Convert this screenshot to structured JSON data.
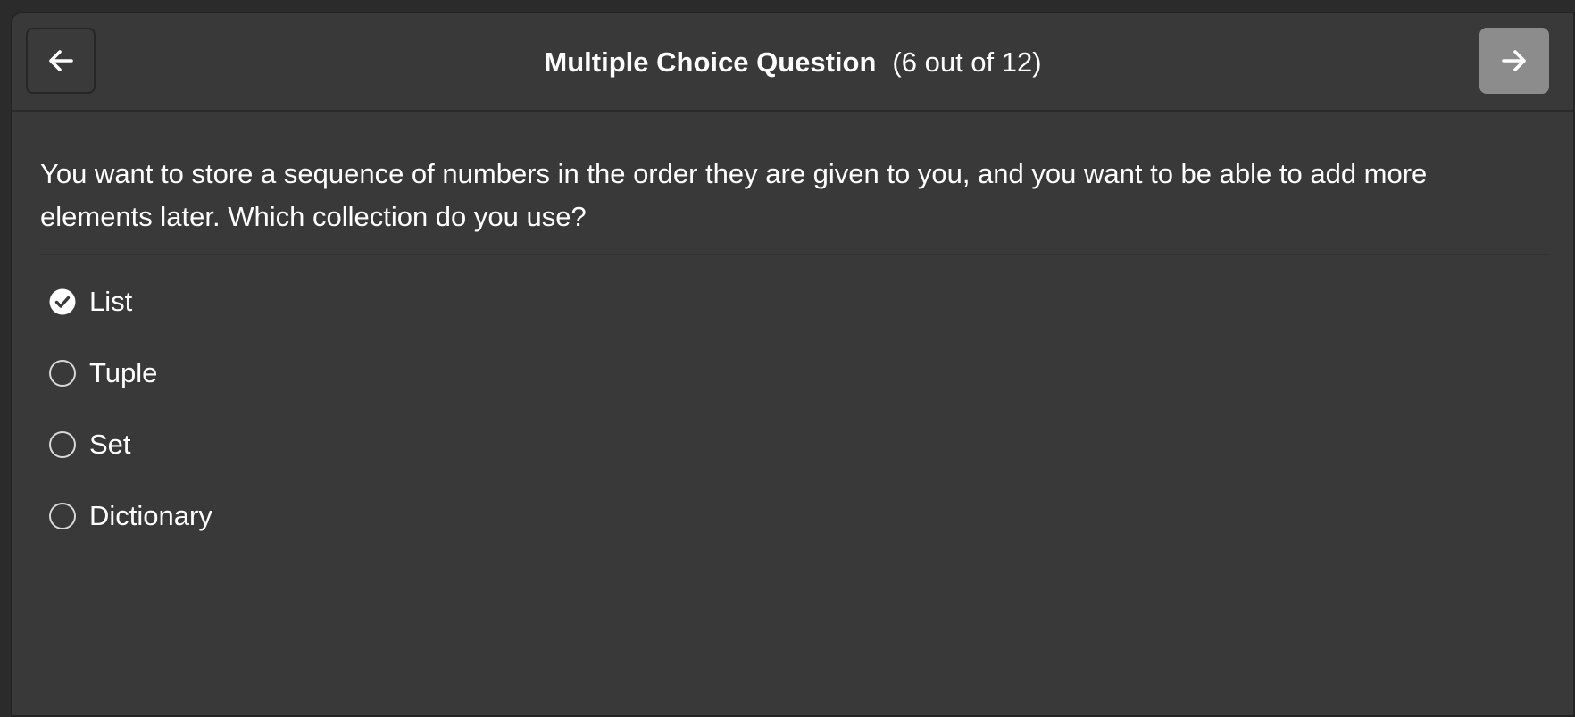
{
  "header": {
    "title": "Multiple Choice Question",
    "progress": "(6 out of 12)",
    "back_icon": "arrow-left-icon",
    "forward_icon": "arrow-right-icon"
  },
  "question": {
    "text": "You want to store a sequence of numbers in the order they are given to you, and you want to be able to add more elements later. Which collection do you use?"
  },
  "options": [
    {
      "label": "List",
      "selected": true
    },
    {
      "label": "Tuple",
      "selected": false
    },
    {
      "label": "Set",
      "selected": false
    },
    {
      "label": "Dictionary",
      "selected": false
    }
  ],
  "colors": {
    "background": "#393939",
    "forward_button": "#8c8c8c",
    "text": "#ffffff"
  }
}
